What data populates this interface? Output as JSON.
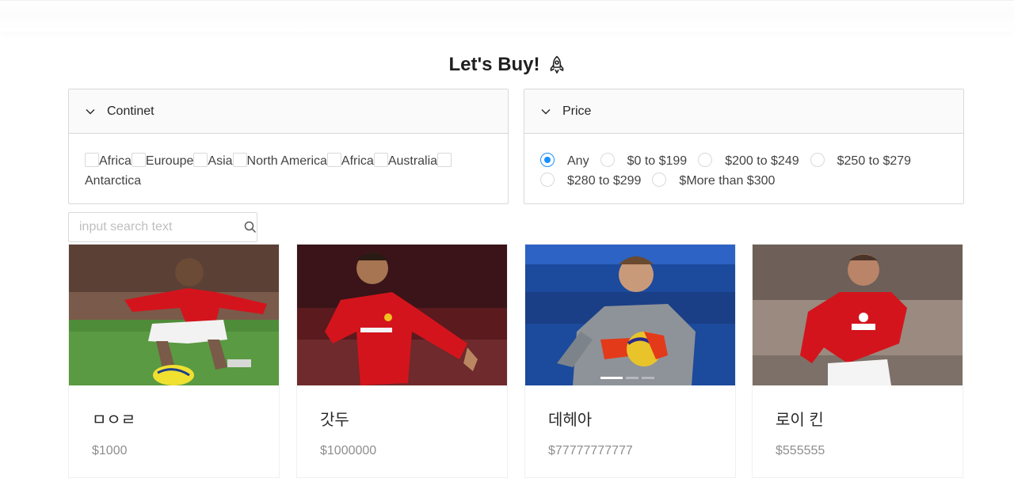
{
  "header": {
    "title": "Let's Buy!",
    "title_icon": "rocket-icon"
  },
  "filters": {
    "continent": {
      "label": "Continet",
      "options": [
        "Africa",
        "Euroupe",
        "Asia",
        "North America",
        "Africa",
        "Australia",
        "Antarctica"
      ]
    },
    "price": {
      "label": "Price",
      "selected": "Any",
      "options": [
        "Any",
        "$0 to $199",
        "$200 to $249",
        "$250 to $279",
        "$280 to $299",
        "$More than $300"
      ]
    }
  },
  "search": {
    "placeholder": "input search text",
    "value": ""
  },
  "products": [
    {
      "name": "ㅁㅇㄹ",
      "price": "$1000"
    },
    {
      "name": "갓두",
      "price": "$1000000"
    },
    {
      "name": "데헤아",
      "price": "$77777777777"
    },
    {
      "name": "로이 킨",
      "price": "$555555"
    }
  ],
  "colors": {
    "accent": "#1890ff",
    "jersey_red": "#d4141c",
    "border": "#d9d9d9"
  }
}
